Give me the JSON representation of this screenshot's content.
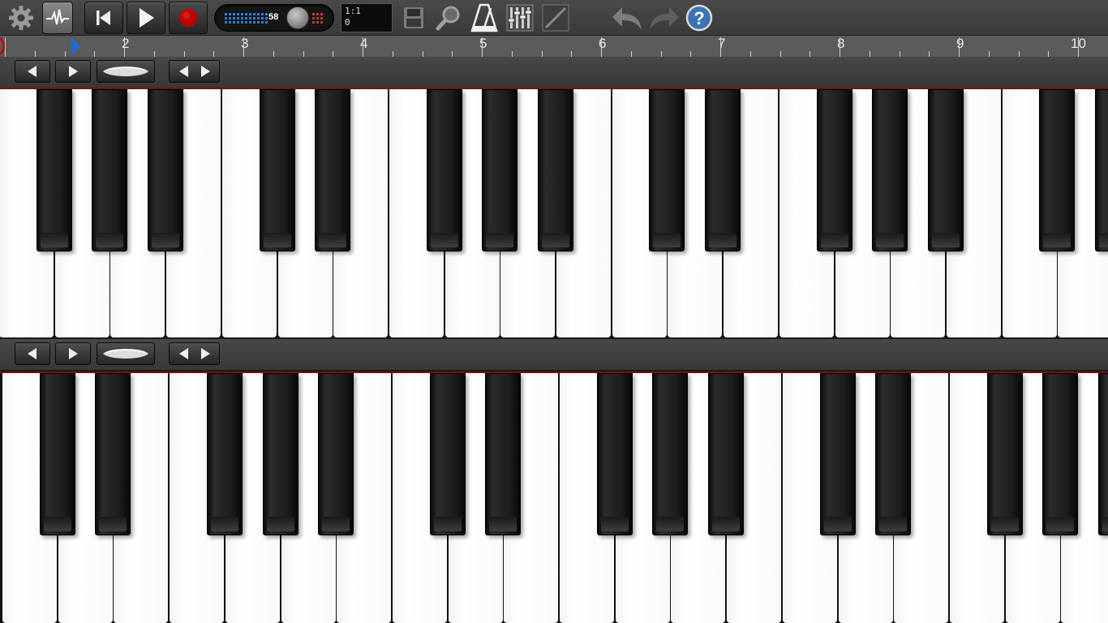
{
  "toolbar": {
    "icons": [
      "gear-icon",
      "waveform-icon",
      "skip-to-start-icon",
      "play-icon",
      "record-icon",
      "save-icon",
      "zoom-icon",
      "metronome-icon",
      "mixer-icon",
      "pencil-icon",
      "undo-icon",
      "redo-icon",
      "help-icon"
    ],
    "tempo": {
      "value": "58"
    },
    "position": {
      "bar_beat": "1:1",
      "tick": "0"
    },
    "help_label": "?"
  },
  "timeline": {
    "bars": [
      "2",
      "3",
      "4",
      "5",
      "6",
      "7",
      "8",
      "9",
      "10"
    ]
  },
  "keyboards": [
    {
      "controls": [
        "octave-down-icon",
        "octave-up-icon",
        "slider-handle-icon",
        "key-width-icon"
      ]
    },
    {
      "controls": [
        "octave-down-icon",
        "octave-up-icon",
        "slider-handle-icon",
        "key-width-icon"
      ]
    }
  ],
  "colors": {
    "accent_red": "#c00000",
    "playhead_blue": "#1e6fd0"
  }
}
